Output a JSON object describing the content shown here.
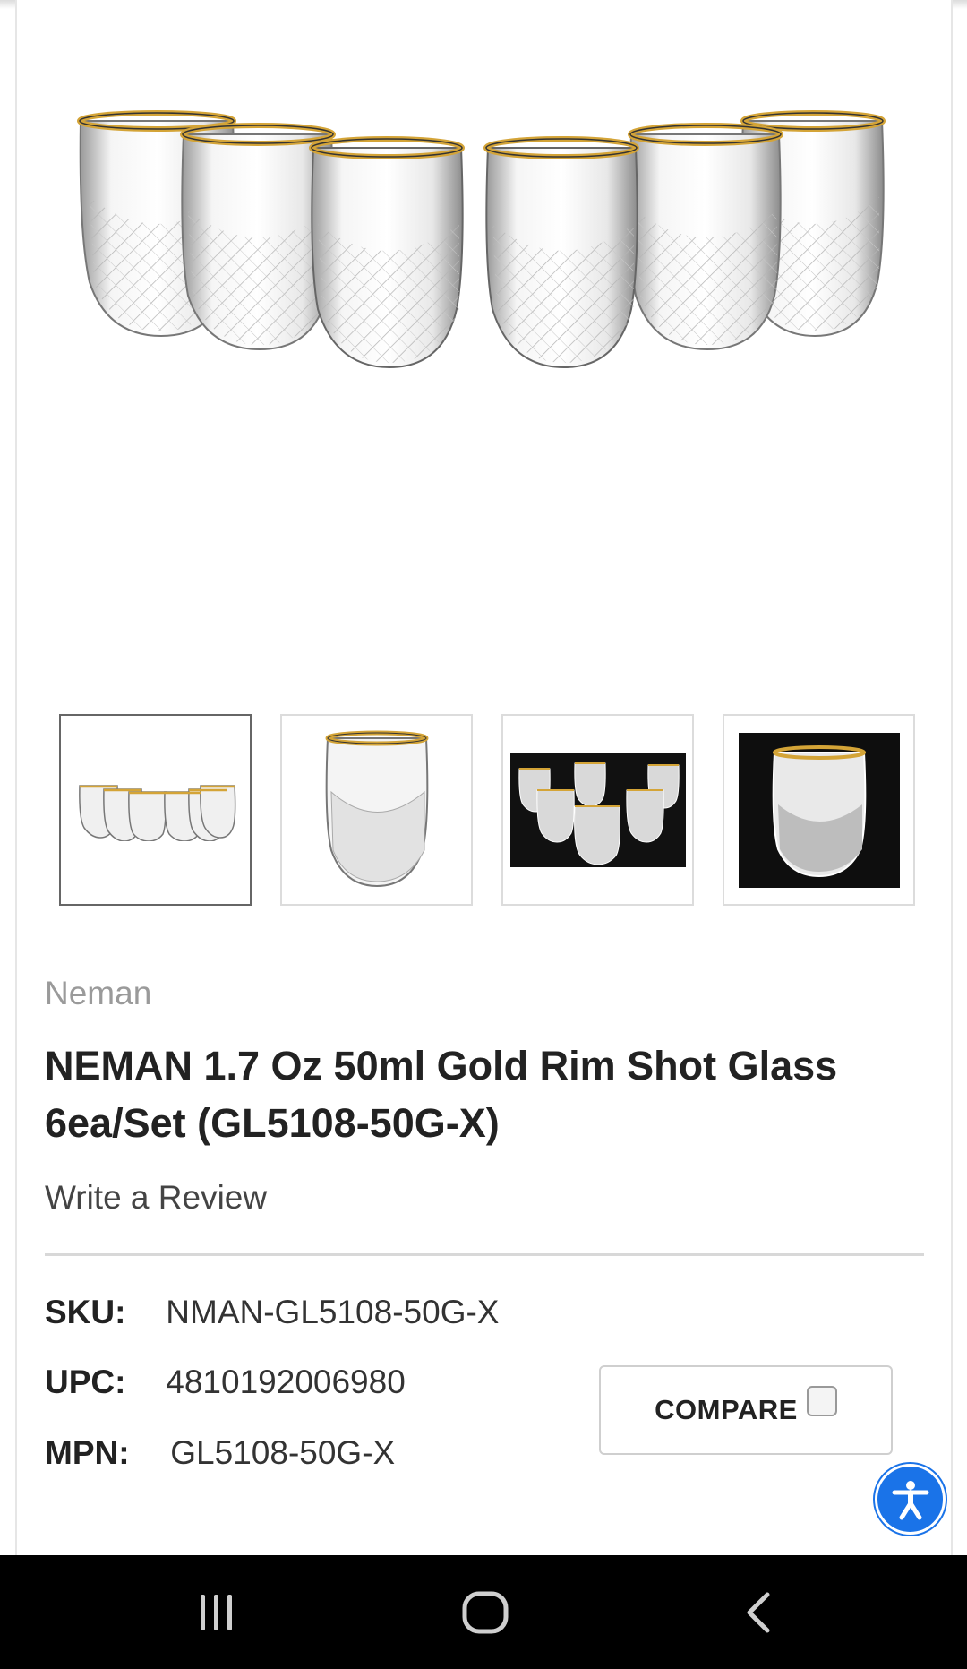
{
  "product": {
    "brand": "Neman",
    "title": "NEMAN 1.7 Oz 50ml Gold Rim Shot Glass 6ea/Set (GL5108-50G-X)",
    "review_link": "Write a Review",
    "specs": [
      {
        "key": "SKU:",
        "value": "NMAN-GL5108-50G-X"
      },
      {
        "key": "UPC:",
        "value": "4810192006980"
      },
      {
        "key": "MPN:",
        "value": "GL5108-50G-X"
      }
    ],
    "compare_label": "COMPARE"
  },
  "gallery": {
    "thumbnails": [
      {
        "name": "six-glasses-white"
      },
      {
        "name": "single-glass-white"
      },
      {
        "name": "five-glasses-black"
      },
      {
        "name": "single-glass-black"
      }
    ],
    "active_index": 0
  },
  "icons": {
    "accessibility": "accessibility-icon",
    "nav_recent": "recent-apps-icon",
    "nav_home": "home-icon",
    "nav_back": "back-icon"
  },
  "colors": {
    "accent": "#1a73e8",
    "gold": "#d4a437"
  }
}
